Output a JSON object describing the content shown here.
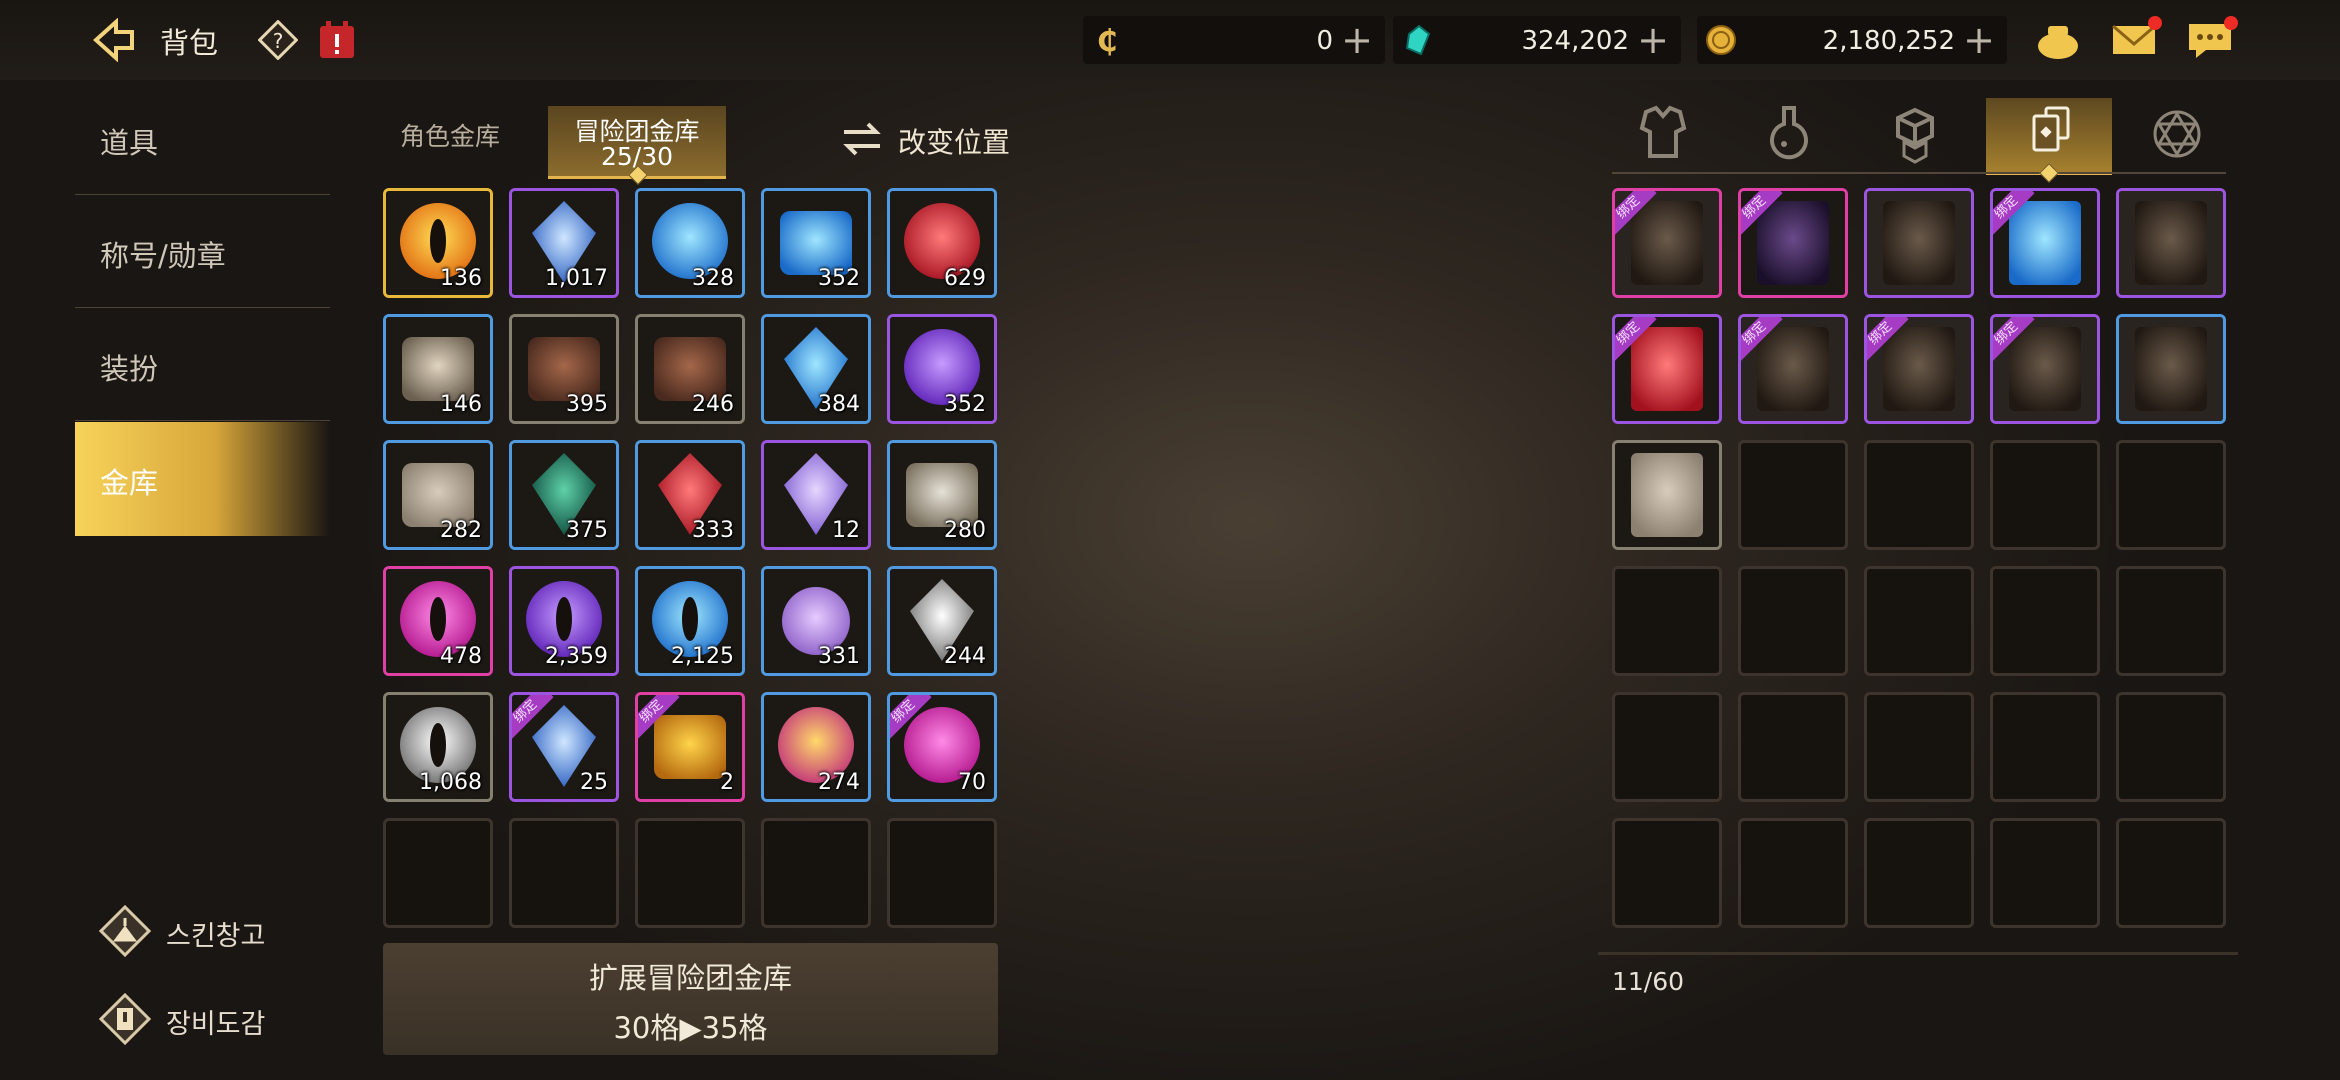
{
  "header": {
    "title": "背包",
    "currencies": [
      {
        "icon": "c-coin-icon",
        "value": "0"
      },
      {
        "icon": "cyan-crystal-icon",
        "value": "324,202"
      },
      {
        "icon": "gold-coin-icon",
        "value": "2,180,252"
      }
    ],
    "plus_label": "+"
  },
  "nav": {
    "items": [
      {
        "label": "道具",
        "active": false
      },
      {
        "label": "称号/勋章",
        "active": false
      },
      {
        "label": "装扮",
        "active": false
      },
      {
        "label": "金库",
        "active": true
      }
    ],
    "bottom_buttons": [
      {
        "label": "스킨창고",
        "icon": "hanger-icon"
      },
      {
        "label": "장비도감",
        "icon": "codex-icon"
      }
    ]
  },
  "tabs": {
    "character_vault": "角色金库",
    "adventure_vault": "冒险团金库",
    "adventure_count": "25/30",
    "swap_label": "改变位置"
  },
  "left_grid": {
    "slots": [
      {
        "icon": "fire-eye-orb",
        "qty": "136",
        "rarity": "gold"
      },
      {
        "icon": "dark-crystal-chest",
        "qty": "1,017",
        "rarity": "purple"
      },
      {
        "icon": "blue-emblem-medal",
        "qty": "328",
        "rarity": "blue"
      },
      {
        "icon": "blue-cloth",
        "qty": "352",
        "rarity": "blue"
      },
      {
        "icon": "red-star-medal",
        "qty": "629",
        "rarity": "blue"
      },
      {
        "icon": "bones",
        "qty": "146",
        "rarity": "blue"
      },
      {
        "icon": "leather-hide",
        "qty": "395",
        "rarity": "gray"
      },
      {
        "icon": "tan-leather",
        "qty": "246",
        "rarity": "gray"
      },
      {
        "icon": "blue-crystal",
        "qty": "384",
        "rarity": "blue"
      },
      {
        "icon": "dark-purple-pearl",
        "qty": "352",
        "rarity": "purple"
      },
      {
        "icon": "stone-chunk",
        "qty": "282",
        "rarity": "blue"
      },
      {
        "icon": "green-gem",
        "qty": "375",
        "rarity": "blue"
      },
      {
        "icon": "red-ruby",
        "qty": "333",
        "rarity": "blue"
      },
      {
        "icon": "violet-crystal",
        "qty": "12",
        "rarity": "purple"
      },
      {
        "icon": "epic-hammer",
        "qty": "280",
        "rarity": "blue"
      },
      {
        "icon": "pink-eye-orb",
        "qty": "478",
        "rarity": "pink"
      },
      {
        "icon": "purple-eye-orb",
        "qty": "2,359",
        "rarity": "purple"
      },
      {
        "icon": "blue-eye-orb",
        "qty": "2,125",
        "rarity": "blue"
      },
      {
        "icon": "grape-orbs",
        "qty": "331",
        "rarity": "blue"
      },
      {
        "icon": "white-diamond",
        "qty": "244",
        "rarity": "blue"
      },
      {
        "icon": "white-eye-orb",
        "qty": "1,068",
        "rarity": "gray"
      },
      {
        "icon": "bound-crystal-chest",
        "qty": "25",
        "rarity": "purple",
        "bound": true
      },
      {
        "icon": "yellow-potion",
        "qty": "2",
        "rarity": "pink",
        "bound": true
      },
      {
        "icon": "swirl-orb-gold",
        "qty": "274",
        "rarity": "blue"
      },
      {
        "icon": "swirl-orb-pink",
        "qty": "70",
        "rarity": "blue",
        "bound": true
      }
    ],
    "bound_label": "绑定"
  },
  "expand": {
    "line1": "扩展冒险团金库",
    "line2": "30格▶35格"
  },
  "right_tabs": [
    {
      "icon": "armor-icon",
      "active": false
    },
    {
      "icon": "potion-icon",
      "active": false
    },
    {
      "icon": "cubes-icon",
      "active": false
    },
    {
      "icon": "cards-icon",
      "active": true
    },
    {
      "icon": "hexagram-icon",
      "active": false
    }
  ],
  "right_grid": {
    "slots": [
      {
        "icon": "card-pumpkin",
        "rarity": "pink",
        "bound": true
      },
      {
        "icon": "card-dark-lady",
        "rarity": "pink",
        "bound": true
      },
      {
        "icon": "card-knight-helm",
        "rarity": "purple"
      },
      {
        "icon": "card-blue-ghoul",
        "rarity": "purple",
        "bound": true
      },
      {
        "icon": "card-orc-face",
        "rarity": "purple"
      },
      {
        "icon": "card-red-mask",
        "rarity": "purple",
        "bound": true
      },
      {
        "icon": "card-ice-golem",
        "rarity": "purple",
        "bound": true
      },
      {
        "icon": "card-jester",
        "rarity": "purple",
        "bound": true
      },
      {
        "icon": "card-witch",
        "rarity": "purple",
        "bound": true
      },
      {
        "icon": "card-shadow-beast",
        "rarity": "blue"
      },
      {
        "icon": "card-stone-golem",
        "rarity": "gray"
      }
    ],
    "count": "11/60"
  },
  "colors": {
    "gold": "#e8b83a",
    "purple": "#9c55e0",
    "blue": "#4f9ae0",
    "pink": "#e03fa5",
    "gray": "#85806f",
    "accent": "#f4d270"
  }
}
